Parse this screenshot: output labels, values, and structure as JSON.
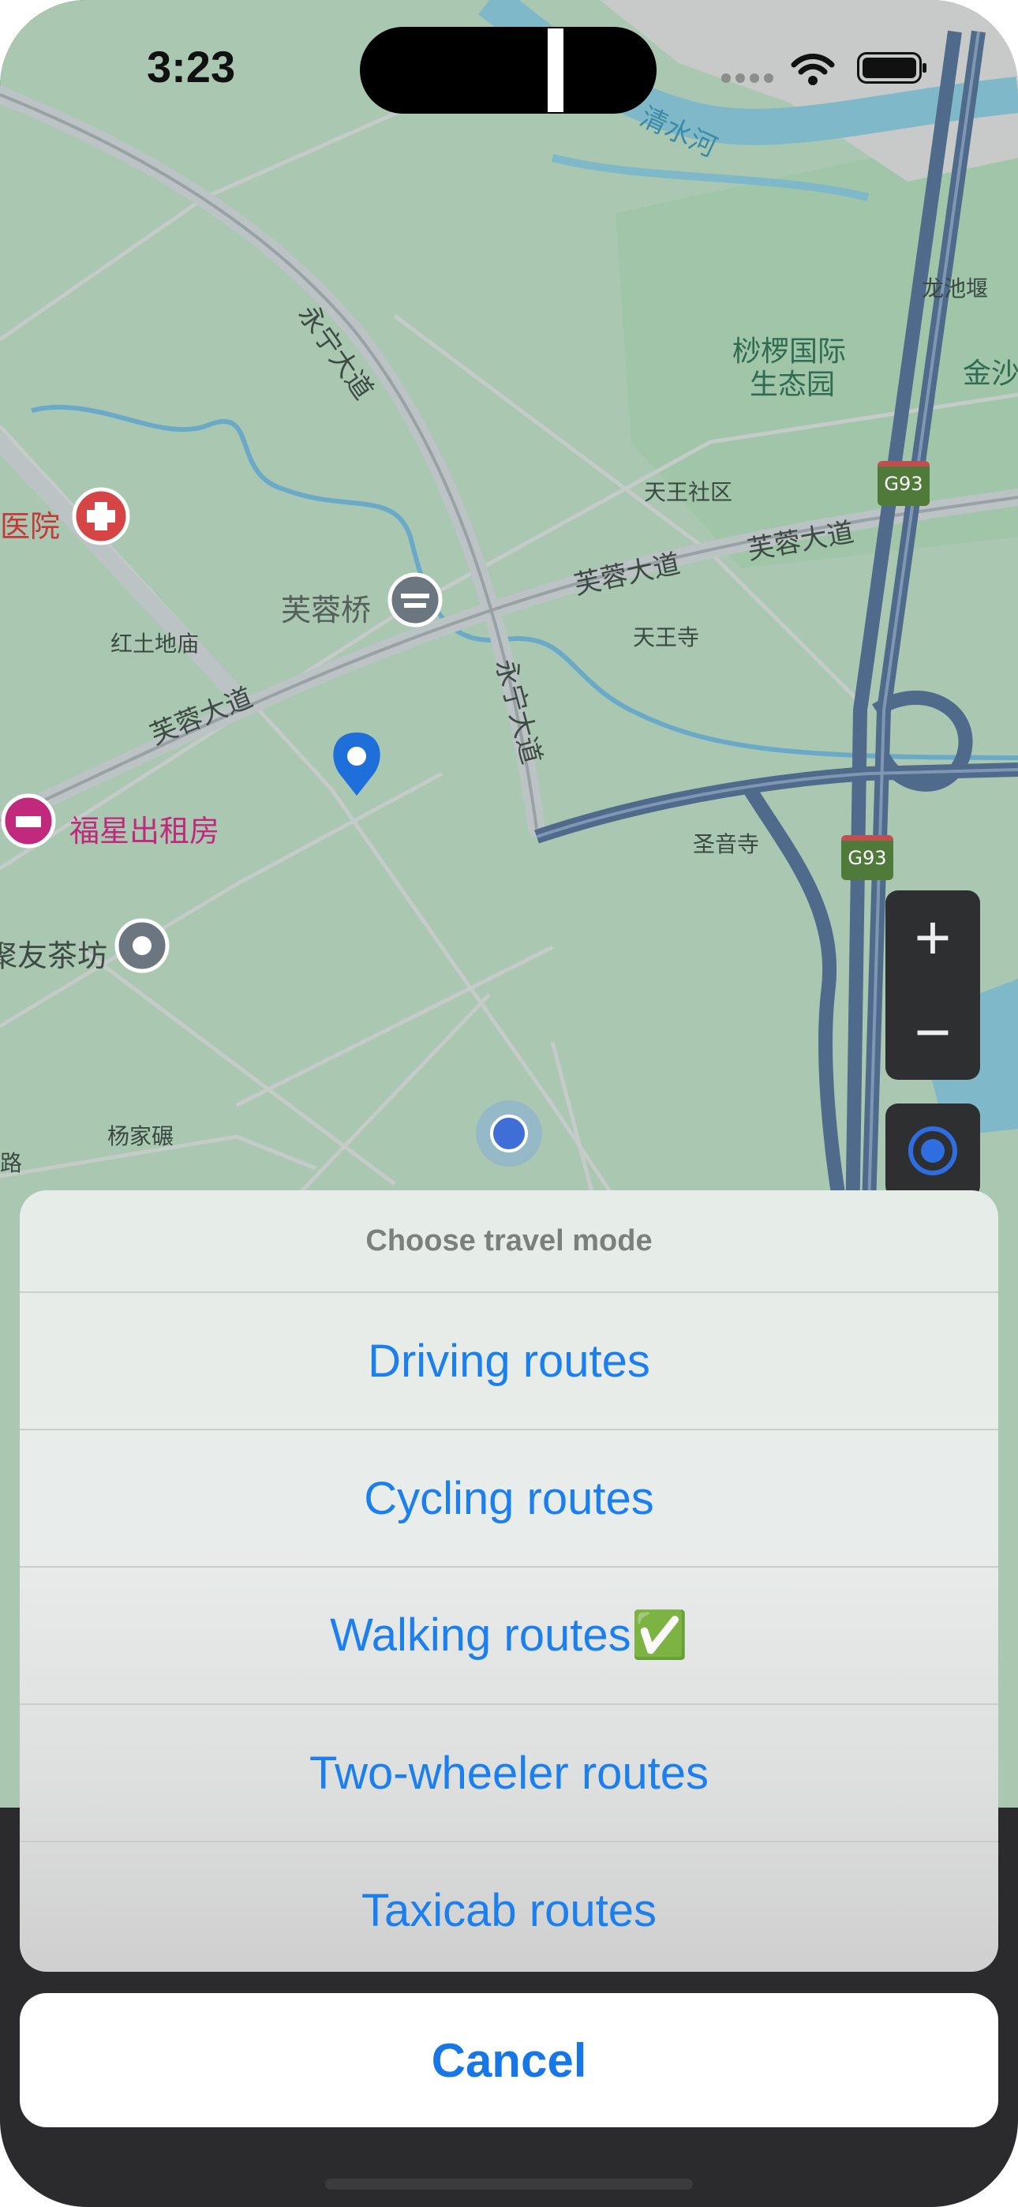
{
  "status_bar": {
    "time": "3:23"
  },
  "map": {
    "labels": {
      "qingshui_river": "清水河",
      "longchi_weir": "龙池堰",
      "suoluo_park": "桫椤国际",
      "suoluo_park_2": "生态园",
      "jinsha": "金沙",
      "tianwang_community": "天王社区",
      "yongning_ave_1": "永宁大道",
      "yongning_ave_2": "永宁大道",
      "furong_ave_1": "芙蓉大道",
      "furong_ave_2": "芙蓉大道",
      "furong_ave_3": "芙蓉大道",
      "furong_bridge": "芙蓉桥",
      "hospital": "医院",
      "hongtu_temple": "红土地庙",
      "tianwang_temple": "天王寺",
      "fuxing_rental": "福星出租房",
      "shengyin_temple": "圣音寺",
      "teahouse": "聚友茶坊",
      "yangjia_nian": "杨家碾",
      "road_left": "路",
      "g93_1": "G93",
      "g93_2": "G93"
    },
    "controls": {
      "zoom_in": "+",
      "zoom_out": "−"
    },
    "icons": [
      "hospital-icon",
      "bridge-icon",
      "hotel-icon",
      "place-icon",
      "map-pin-icon",
      "current-location-icon",
      "locate-me-icon"
    ]
  },
  "action_sheet": {
    "title": "Choose travel mode",
    "options": [
      "Driving routes",
      "Cycling routes",
      "Walking routes✅",
      "Two-wheeler routes",
      "Taxicab routes"
    ],
    "cancel": "Cancel"
  },
  "colors": {
    "accent": "#1b7ff0",
    "map_background": "#a9c7b1",
    "highway": "#4f6a8a",
    "water": "#7fb8c8"
  }
}
